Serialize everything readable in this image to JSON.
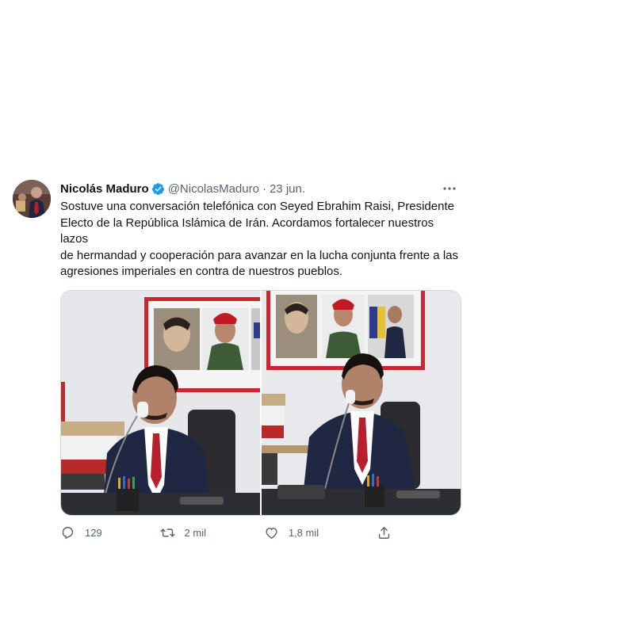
{
  "tweet": {
    "author_name": "Nicolás Maduro",
    "handle": "@NicolasMaduro",
    "separator": "·",
    "date": "23 jun.",
    "text": "Sostuve una conversación telefónica con Seyed Ebrahim Raisi, Presidente\nElecto de la República Islámica de Irán. Acordamos fortalecer nuestros lazos\nde hermandad y cooperación para avanzar en la lucha conjunta frente a las\nagresiones imperiales en contra de nuestros pueblos.",
    "verified_icon": "verified-badge-icon",
    "more_icon": "more-options-icon"
  },
  "actions": {
    "reply_count": "129",
    "retweet_count": "2 mil",
    "like_count": "1,8 mil",
    "reply_icon": "reply-icon",
    "retweet_icon": "retweet-icon",
    "like_icon": "heart-icon",
    "share_icon": "share-icon"
  },
  "colors": {
    "verified_blue": "#1d9bf0",
    "secondary_text": "#536471",
    "primary_text": "#0f1419"
  }
}
